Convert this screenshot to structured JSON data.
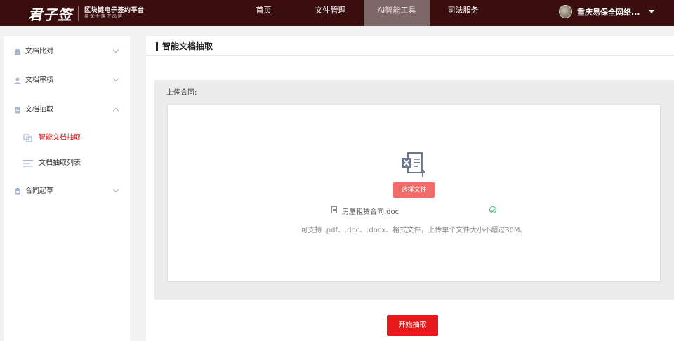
{
  "header": {
    "logo_main": "君子签",
    "logo_line1": "区块链电子签约平台",
    "logo_line2": "易保全旗下品牌",
    "nav": [
      {
        "label": "首页"
      },
      {
        "label": "文件管理"
      },
      {
        "label": "AI智能工具",
        "active": true
      },
      {
        "label": "司法服务"
      }
    ],
    "user_name": "重庆易保全网络..."
  },
  "sidebar": {
    "items": [
      {
        "label": "文档比对",
        "icon": "layers-icon"
      },
      {
        "label": "文档审核",
        "icon": "user-icon"
      },
      {
        "label": "文档抽取",
        "icon": "document-icon",
        "expanded": true
      },
      {
        "label": "合同起草",
        "icon": "clipboard-icon"
      }
    ],
    "sub_items": [
      {
        "label": "智能文档抽取",
        "icon": "copy-icon",
        "active": true
      },
      {
        "label": "文档抽取列表",
        "icon": "list-icon"
      }
    ]
  },
  "main": {
    "title": "智能文档抽取",
    "upload_label": "上传合同:",
    "choose_button": "选择文件",
    "file_name": "房屋租赁合同.doc",
    "hint": "可支持 .pdf、.doc、.docx、格式文件，上传单个文件大小不超过30M。",
    "start_button": "开始抽取"
  },
  "colors": {
    "topbar": "#3a0d0f",
    "nav_active": "#7e6767",
    "accent_red": "#e8191b",
    "choose_button": "#f26b6b",
    "sub_active_text": "#e8191b"
  }
}
